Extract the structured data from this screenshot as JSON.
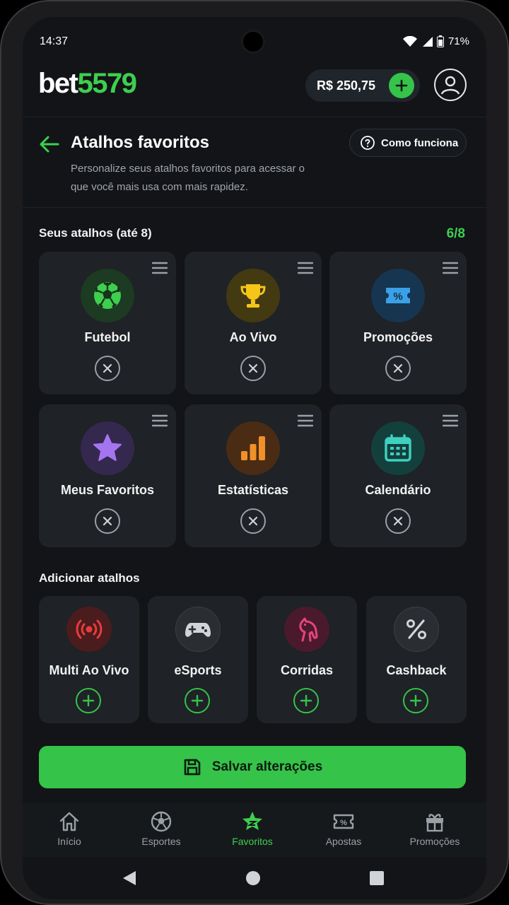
{
  "status": {
    "time": "14:37",
    "battery": "71%"
  },
  "header": {
    "logo_a": "bet",
    "logo_b": "5579",
    "balance": "R$ 250,75"
  },
  "page": {
    "title": "Atalhos favoritos",
    "how_label": "Como funciona",
    "subtitle": "Personalize seus atalhos favoritos para acessar o que você mais usa com mais rapidez."
  },
  "favorites": {
    "label": "Seus atalhos (até 8)",
    "count": "6/8",
    "items": [
      {
        "label": "Futebol",
        "icon": "soccer-ball-icon",
        "color": "#3ecf4f"
      },
      {
        "label": "Ao Vivo",
        "icon": "trophy-icon",
        "color": "#f5c518"
      },
      {
        "label": "Promoções",
        "icon": "ticket-percent-icon",
        "color": "#3aa0e8"
      },
      {
        "label": "Meus Favoritos",
        "icon": "star-icon",
        "color": "#a575f0"
      },
      {
        "label": "Estatísticas",
        "icon": "bar-chart-icon",
        "color": "#f0902a"
      },
      {
        "label": "Calendário",
        "icon": "calendar-icon",
        "color": "#3ed1c0"
      }
    ]
  },
  "add": {
    "label": "Adicionar atalhos",
    "items": [
      {
        "label": "Multi Ao Vivo",
        "icon": "live-broadcast-icon",
        "color": "#e83c3c"
      },
      {
        "label": "eSports",
        "icon": "gamepad-icon",
        "color": "#d0d4d8"
      },
      {
        "label": "Corridas",
        "icon": "horse-icon",
        "color": "#e8447a"
      },
      {
        "label": "Cashback",
        "icon": "percent-icon",
        "color": "#d0d4d8"
      }
    ]
  },
  "save_label": "Salvar alterações",
  "nav": {
    "items": [
      {
        "label": "Início",
        "icon": "home-icon"
      },
      {
        "label": "Esportes",
        "icon": "soccer-ball-icon"
      },
      {
        "label": "Favoritos",
        "icon": "star-badge-icon",
        "active": true
      },
      {
        "label": "Apostas",
        "icon": "ticket-icon"
      },
      {
        "label": "Promoções",
        "icon": "gift-icon"
      }
    ]
  },
  "colors": {
    "accent": "#3ecf4f",
    "background": "#121417",
    "card": "#1f2226"
  }
}
